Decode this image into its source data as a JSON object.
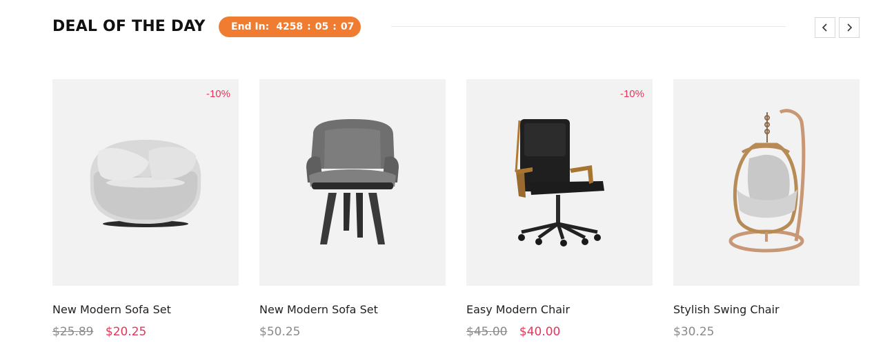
{
  "section": {
    "title": "DEAL OF THE DAY",
    "countdown": {
      "label": "End In:",
      "days": "4258",
      "hours": "05",
      "minutes": "07",
      "separator": ":"
    },
    "accent_color": "#f07c31",
    "sale_color": "#e8345a"
  },
  "nav": {
    "prev_icon": "chevron-left-icon",
    "next_icon": "chevron-right-icon"
  },
  "products": [
    {
      "name": "New Modern Sofa Set",
      "discount": "-10%",
      "old_price": "$25.89",
      "price": "$20.25",
      "image": "round-sofa-chair"
    },
    {
      "name": "New Modern Sofa Set",
      "discount": "",
      "old_price": "",
      "price": "$50.25",
      "image": "gray-lounge-chair"
    },
    {
      "name": "Easy Modern Chair",
      "discount": "-10%",
      "old_price": "$45.00",
      "price": "$40.00",
      "image": "black-office-chair"
    },
    {
      "name": "Stylish Swing Chair",
      "discount": "",
      "old_price": "",
      "price": "$30.25",
      "image": "hanging-swing-chair"
    }
  ]
}
